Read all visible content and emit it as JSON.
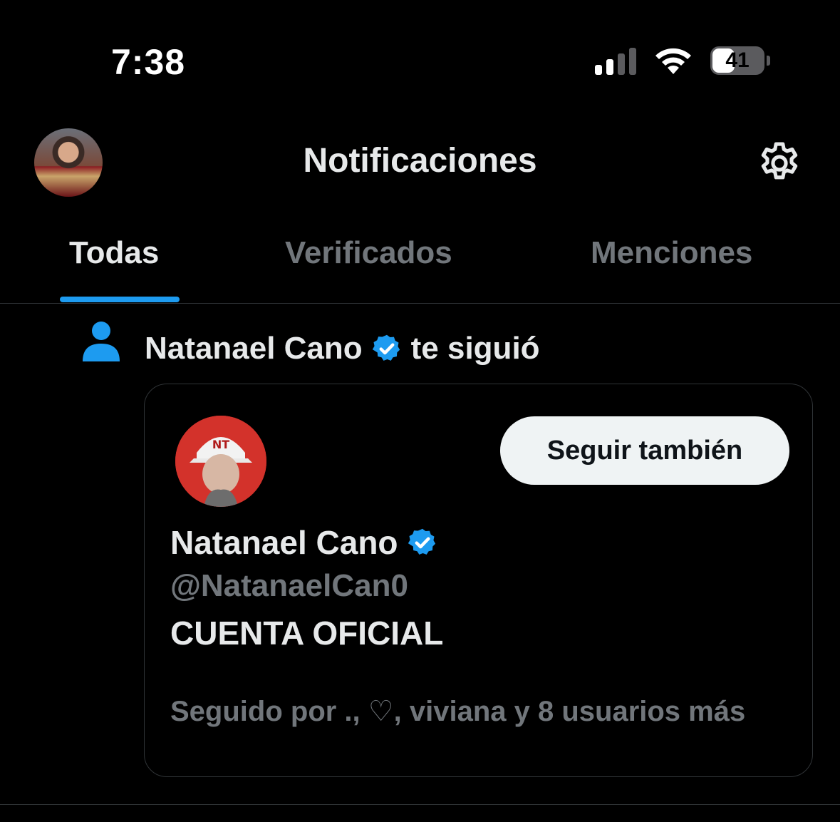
{
  "status_bar": {
    "time": "7:38",
    "battery_level": "41",
    "icons": [
      "cellular-signal-icon",
      "wifi-icon",
      "battery-icon"
    ]
  },
  "header": {
    "title": "Notificaciones",
    "avatar": "profile-avatar",
    "settings_icon": "gear-icon"
  },
  "tabs": [
    {
      "label": "Todas",
      "active": true
    },
    {
      "label": "Verificados",
      "active": false
    },
    {
      "label": "Menciones",
      "active": false
    }
  ],
  "notification": {
    "icon": "person-icon",
    "actor_name": "Natanael Cano",
    "action_text": "te siguió",
    "card": {
      "name": "Natanael Cano",
      "handle": "@NatanaelCan0",
      "bio": "CUENTA OFICIAL",
      "follow_button_label": "Seguir también",
      "followed_by": "Seguido por ., ♡, viviana y 8 usuarios más"
    }
  },
  "colors": {
    "background": "#000000",
    "accent": "#1d9bf0",
    "text_primary": "#e7e9ea",
    "text_secondary": "#71767b",
    "border": "#2f3336",
    "button_bg": "#eff3f4"
  }
}
